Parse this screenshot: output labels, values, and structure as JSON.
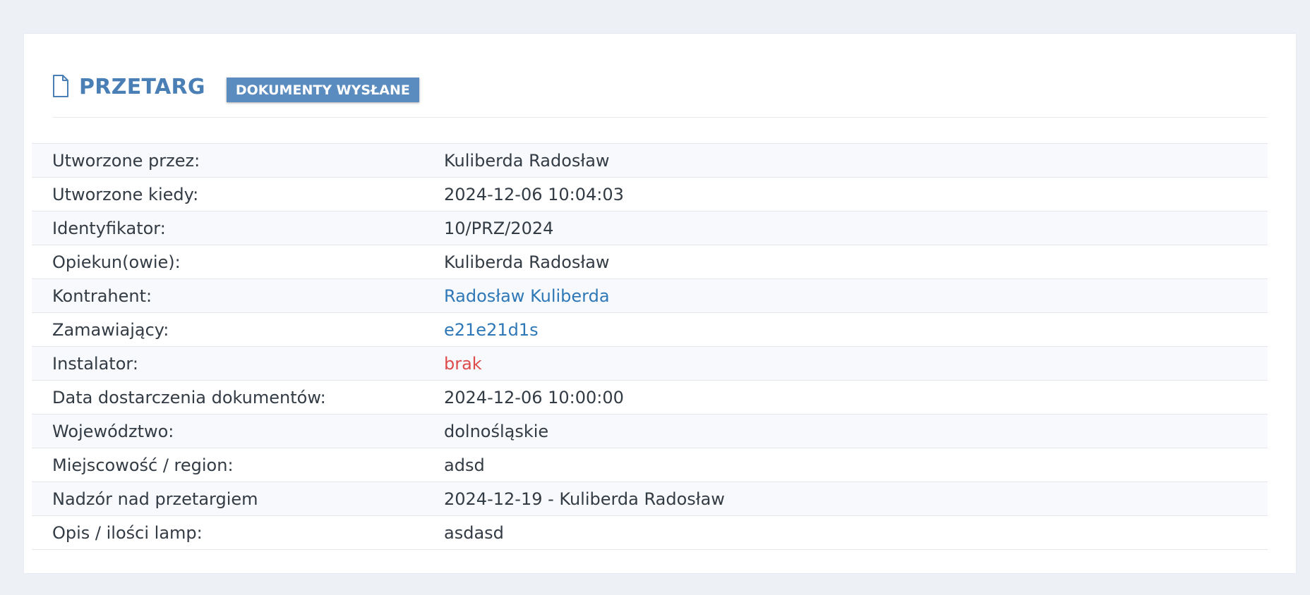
{
  "header": {
    "title": "PRZETARG",
    "status_badge": "DOKUMENTY WYSŁANE",
    "icon": "document-icon"
  },
  "colors": {
    "accent": "#4a7fb5",
    "badge": "#5b8cc0",
    "link": "#2f78b7",
    "missing": "#de4b4b"
  },
  "details": {
    "rows": [
      {
        "label": "Utworzone przez:",
        "value": "Kuliberda Radosław"
      },
      {
        "label": "Utworzone kiedy:",
        "value": "2024-12-06 10:04:03"
      },
      {
        "label": "Identyfikator:",
        "value": "10/PRZ/2024"
      },
      {
        "label": "Opiekun(owie):",
        "value": "Kuliberda Radosław"
      },
      {
        "label": "Kontrahent:",
        "value": "Radosław Kuliberda"
      },
      {
        "label": "Zamawiający:",
        "value": "e21e21d1s"
      },
      {
        "label": "Instalator:",
        "value": "brak"
      },
      {
        "label": "Data dostarczenia dokumentów:",
        "value": "2024-12-06 10:00:00"
      },
      {
        "label": "Województwo:",
        "value": "dolnośląskie"
      },
      {
        "label": "Miejscowość / region:",
        "value": "adsd"
      },
      {
        "label": "Nadzór nad przetargiem",
        "value": "2024-12-19 - Kuliberda Radosław"
      },
      {
        "label": "Opis / ilości lamp:",
        "value": "asdasd"
      }
    ]
  }
}
